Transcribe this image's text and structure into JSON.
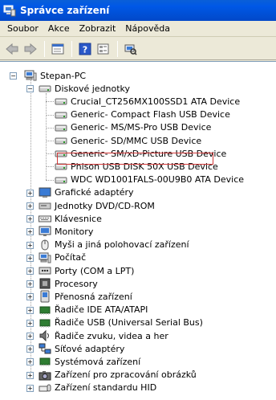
{
  "window": {
    "title": "Správce zařízení"
  },
  "menu": [
    {
      "label": "Soubor"
    },
    {
      "label": "Akce"
    },
    {
      "label": "Zobrazit"
    },
    {
      "label": "Nápověda"
    }
  ],
  "toolbar": {
    "icons": [
      "back-arrow-icon",
      "forward-arrow-icon",
      "properties-icon",
      "help-icon",
      "show-hidden-icon",
      "scan-hardware-icon"
    ]
  },
  "tree": {
    "root": "Stepan-PC",
    "disks_label": "Diskové jednotky",
    "disks": [
      "Crucial_CT256MX100SSD1 ATA Device",
      "Generic- Compact Flash USB Device",
      "Generic- MS/MS-Pro USB Device",
      "Generic- SD/MMC USB Device",
      "Generic- SM/xD-Picture USB Device",
      "Phison USB DISK 50X USB Device",
      "WDC WD1001FALS-00U9B0 ATA Device"
    ],
    "categories": [
      "Grafické adaptéry",
      "Jednotky DVD/CD-ROM",
      "Klávesnice",
      "Monitory",
      "Myši a jiná polohovací zařízení",
      "Počítač",
      "Porty (COM a LPT)",
      "Procesory",
      "Přenosná zařízení",
      "Řadiče IDE ATA/ATAPI",
      "Řadiče USB (Universal Serial Bus)",
      "Řadiče zvuku, videa a her",
      "Síťové adaptéry",
      "Systémová zařízení",
      "Zařízení pro zpracování obrázků",
      "Zařízení standardu HID"
    ]
  },
  "colors": {
    "titlebar": "#0054e3",
    "highlight_box": "#d23a3a"
  }
}
